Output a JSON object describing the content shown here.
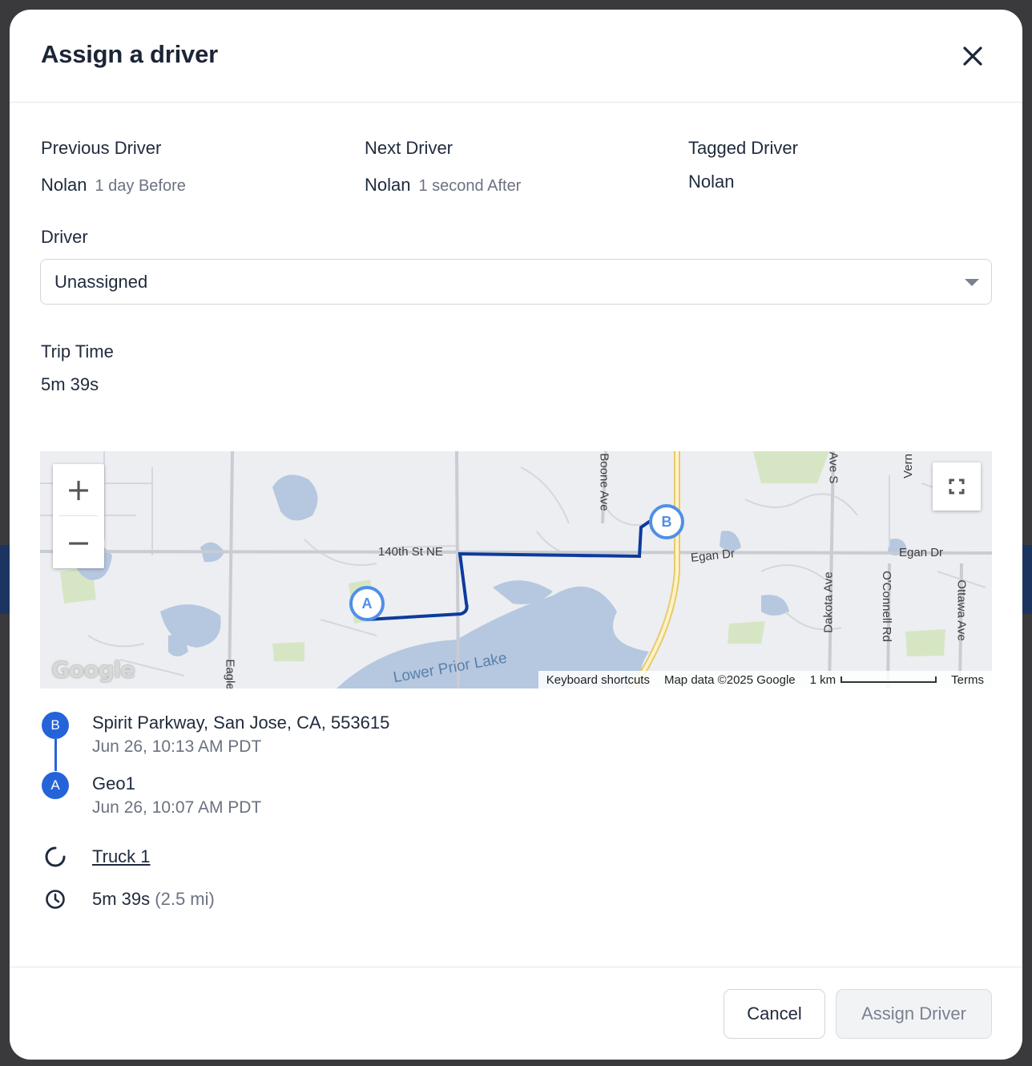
{
  "modal": {
    "title": "Assign a driver"
  },
  "drivers": {
    "previous": {
      "label": "Previous Driver",
      "name": "Nolan",
      "relative": "1 day Before"
    },
    "next": {
      "label": "Next Driver",
      "name": "Nolan",
      "relative": "1 second After"
    },
    "tagged": {
      "label": "Tagged Driver",
      "name": "Nolan"
    }
  },
  "driver_select": {
    "label": "Driver",
    "selected": "Unassigned"
  },
  "trip_time": {
    "label": "Trip Time",
    "value": "5m 39s"
  },
  "map": {
    "zoom_in": "+",
    "zoom_out": "−",
    "marker_a": "A",
    "marker_b": "B",
    "streets": {
      "s140th": "140th St NE",
      "egan1": "Egan Dr",
      "egan2": "Egan Dr",
      "boone": "Boone Ave",
      "eagle": "Eagle",
      "dakota": "Dakota Ave",
      "oconnell": "O'Connell Rd",
      "ottawa": "Ottawa Ave",
      "ave_s": "Ave S",
      "vern": "Vern"
    },
    "lake": "Lower Prior Lake",
    "google_logo": "Google",
    "attribution": {
      "shortcuts": "Keyboard shortcuts",
      "map_data": "Map data ©2025 Google",
      "scale": "1 km",
      "terms": "Terms"
    },
    "route_color": "#0d3b9c",
    "marker_color": "#4f8fe8"
  },
  "stops": [
    {
      "badge": "B",
      "title": "Spirit Parkway, San Jose, CA, 553615",
      "time": "Jun 26, 10:13 AM PDT"
    },
    {
      "badge": "A",
      "title": "Geo1",
      "time": "Jun 26, 10:07 AM PDT"
    }
  ],
  "vehicle": {
    "icon": "loading-spinner-icon",
    "name": "Truck 1"
  },
  "duration": {
    "icon": "clock-icon",
    "time": "5m 39s",
    "distance": "(2.5 mi)"
  },
  "footer": {
    "cancel": "Cancel",
    "assign": "Assign Driver"
  },
  "colors": {
    "accent": "#2563d9",
    "text": "#1f2a3c",
    "muted": "#6b7280"
  }
}
